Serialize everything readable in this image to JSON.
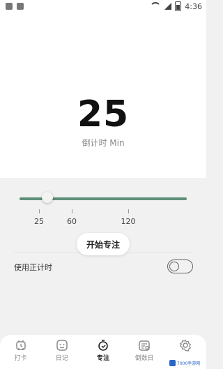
{
  "status_bar": {
    "time": "4:36"
  },
  "timer": {
    "value": "25",
    "caption": "倒计时 Min"
  },
  "slider": {
    "value": 25,
    "min": 0,
    "max": 150,
    "marks": [
      "25",
      "60",
      "120"
    ]
  },
  "actions": {
    "start_label": "开始专注"
  },
  "settings": {
    "count_up_label": "使用正计时",
    "count_up_enabled": false
  },
  "tabs": [
    {
      "label": "打卡",
      "icon": "punch-card-icon",
      "active": false
    },
    {
      "label": "日记",
      "icon": "diary-icon",
      "active": false
    },
    {
      "label": "专注",
      "icon": "focus-icon",
      "active": true
    },
    {
      "label": "倒数日",
      "icon": "countdown-days-icon",
      "active": false
    },
    {
      "label": "",
      "icon": "settings-gear-icon",
      "active": false
    }
  ],
  "watermark": {
    "text": "7000手游网"
  },
  "colors": {
    "accent": "#5e8f78",
    "background": "#f1f1f1"
  }
}
